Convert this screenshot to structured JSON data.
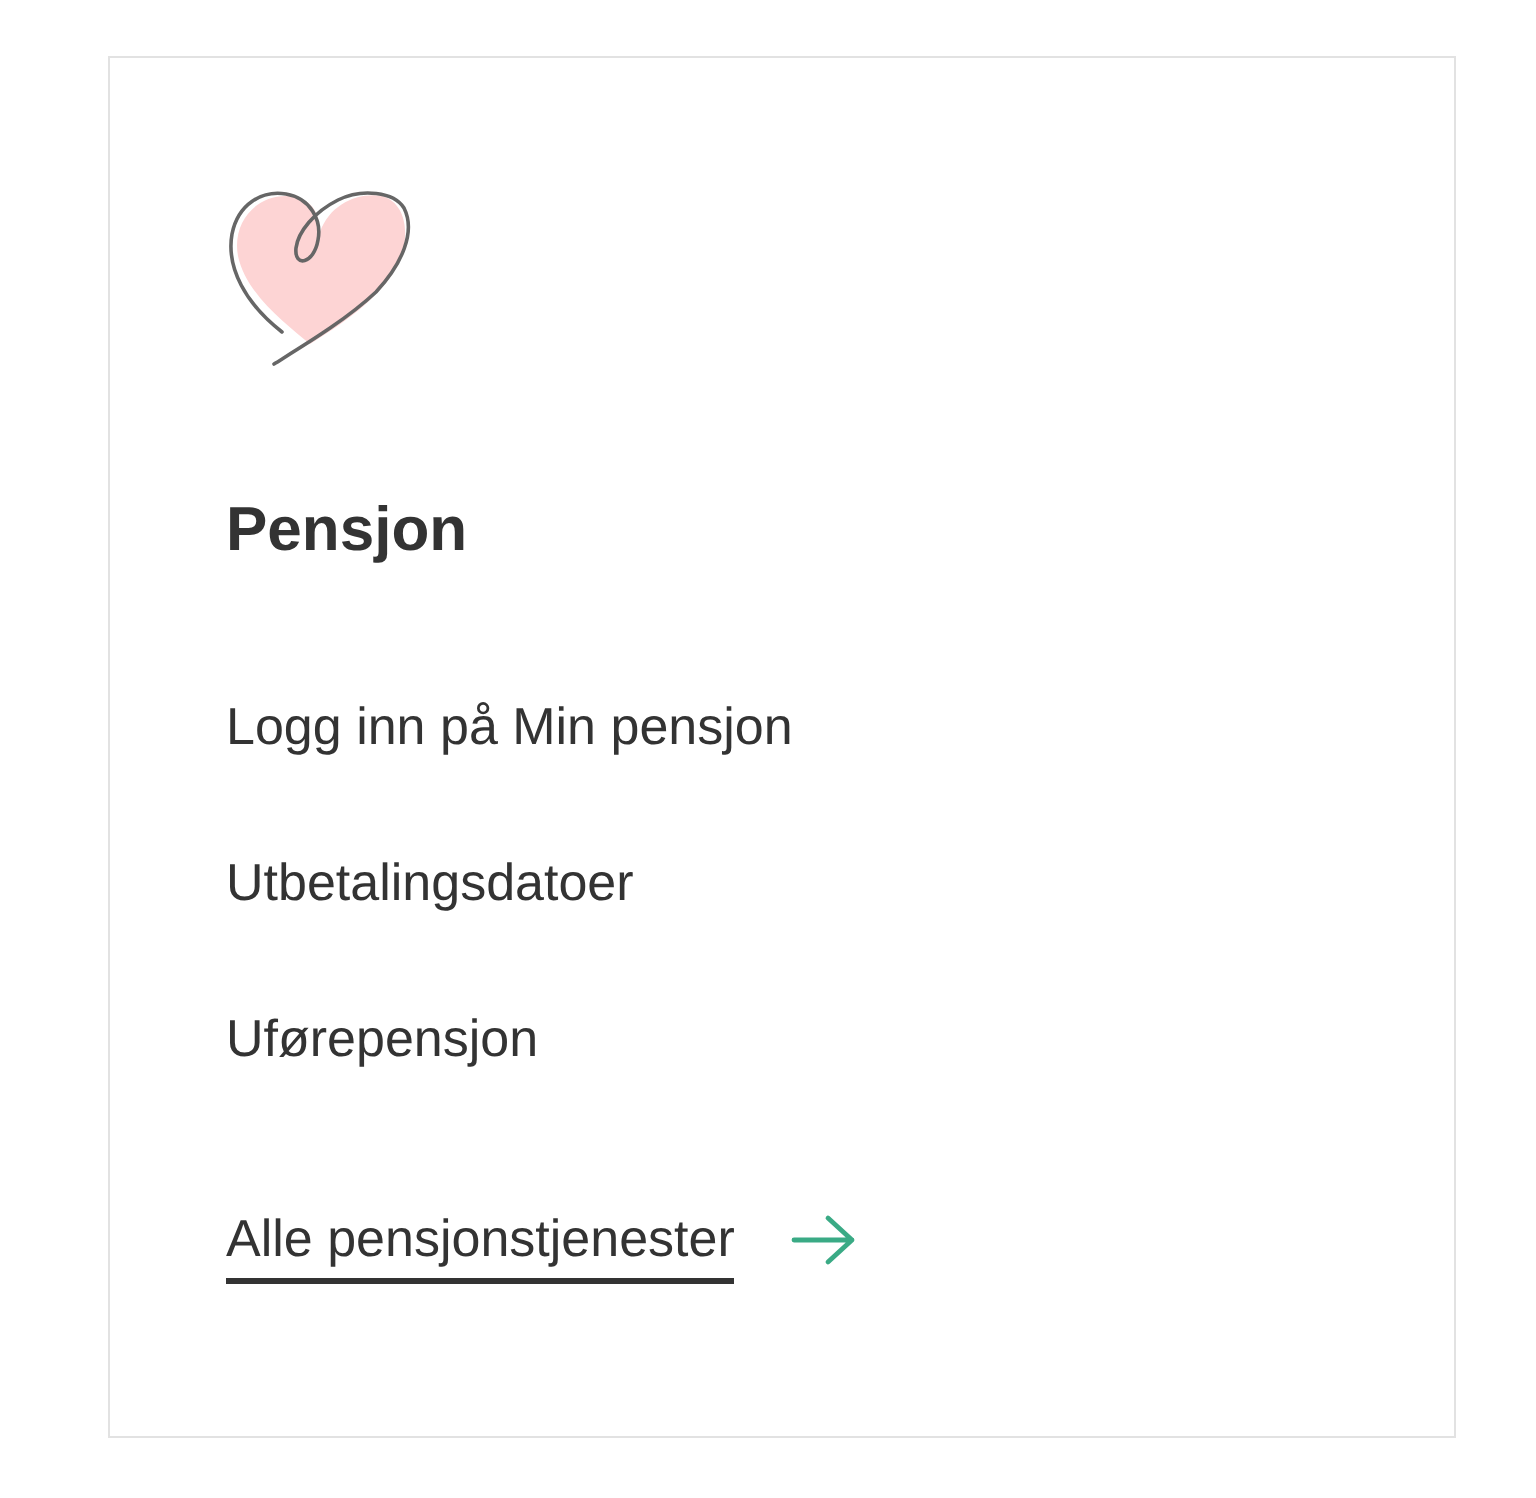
{
  "card": {
    "title": "Pensjon",
    "links": [
      "Logg inn på Min pensjon",
      "Utbetalingsdatoer",
      "Uførepensjon"
    ],
    "all_link": {
      "label": "Alle pensjonstjenester"
    }
  }
}
